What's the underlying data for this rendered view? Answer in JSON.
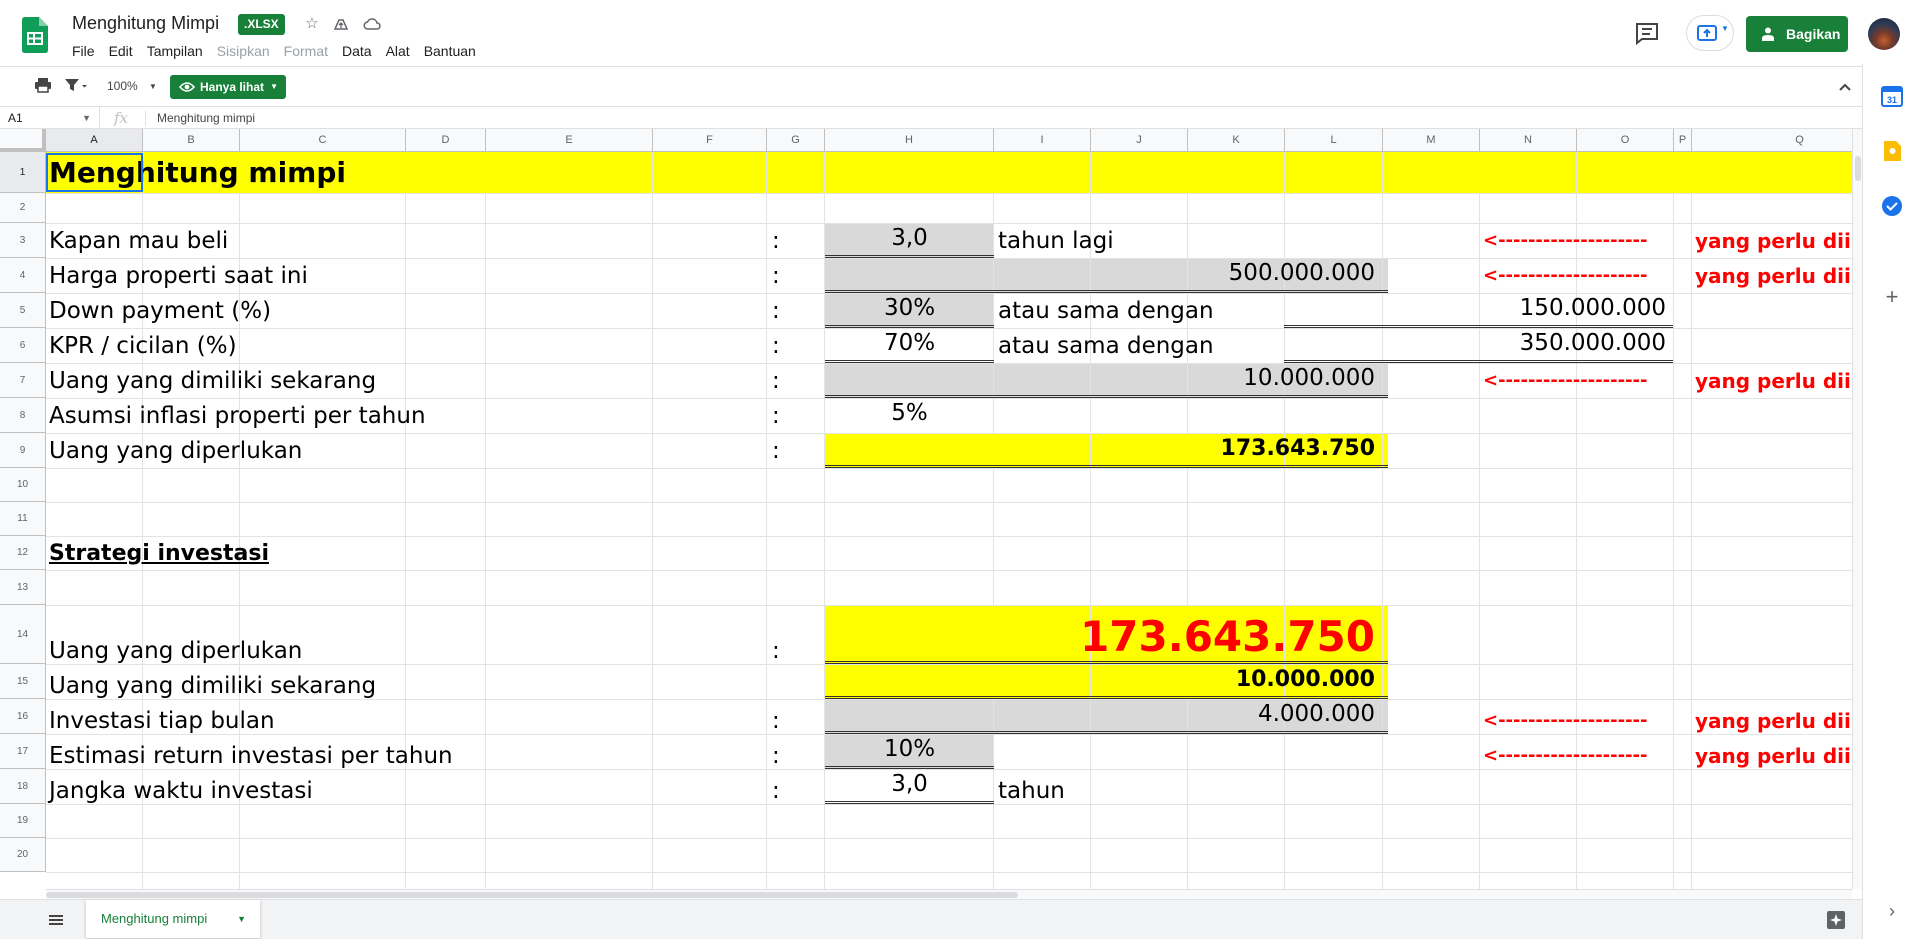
{
  "header": {
    "doc_title": "Menghitung Mimpi",
    "badge": ".XLSX",
    "share_label": "Bagikan"
  },
  "menu": [
    "File",
    "Edit",
    "Tampilan",
    "Sisipkan",
    "Format",
    "Data",
    "Alat",
    "Bantuan"
  ],
  "menu_disabled": [
    "Sisipkan",
    "Format"
  ],
  "toolbar": {
    "zoom": "100%",
    "view_only_label": "Hanya lihat"
  },
  "formula_bar": {
    "cell_ref": "A1",
    "fx": "fx",
    "content": "Menghitung mimpi"
  },
  "columns": [
    "A",
    "B",
    "C",
    "D",
    "E",
    "F",
    "G",
    "H",
    "I",
    "J",
    "K",
    "L",
    "M",
    "N",
    "O",
    "P",
    "Q"
  ],
  "rows": [
    "1",
    "2",
    "3",
    "4",
    "5",
    "6",
    "7",
    "8",
    "9",
    "10",
    "11",
    "12",
    "13",
    "14",
    "15",
    "16",
    "17",
    "18",
    "19",
    "20"
  ],
  "sheet": {
    "title": "Menghitung mimpi",
    "labels": {
      "r3": "Kapan mau beli",
      "r4": "Harga properti saat ini",
      "r5": "Down payment (%)",
      "r6": "KPR / cicilan (%)",
      "r7": "Uang yang dimiliki sekarang",
      "r8": "Asumsi inflasi properti per tahun",
      "r9": "Uang yang diperlukan",
      "r12": "Strategi investasi",
      "r14": "Uang yang diperlukan",
      "r15": "Uang yang dimiliki sekarang",
      "r16": "Investasi tiap bulan",
      "r17": "Estimasi return investasi per tahun",
      "r18": "Jangka waktu investasi"
    },
    "colon": ":",
    "values": {
      "r3_h": "3,0",
      "r3_unit": "tahun lagi",
      "r4_k": "500.000.000",
      "r5_h": "30%",
      "r5_text": "atau  sama dengan",
      "r5_n": "150.000.000",
      "r6_h": "70%",
      "r6_text": "atau  sama dengan",
      "r6_n": "350.000.000",
      "r7_k": "10.000.000",
      "r8_h": "5%",
      "r9_k": "173.643.750",
      "r14_k": "173.643.750",
      "r15_k": "10.000.000",
      "r16_k": "4.000.000",
      "r17_h": "10%",
      "r18_h": "3,0",
      "r18_unit": "tahun"
    },
    "arrow": "<--------------------",
    "note": "yang perlu diisi"
  },
  "tabs": [
    {
      "label": "Menghitung mimpi",
      "active": true
    }
  ],
  "colors": {
    "brand_green": "#188038",
    "highlight_yellow": "#ffff00",
    "input_gray": "#d9d9d9",
    "warning_red": "#ff0000",
    "selection_blue": "#1a73e8"
  }
}
